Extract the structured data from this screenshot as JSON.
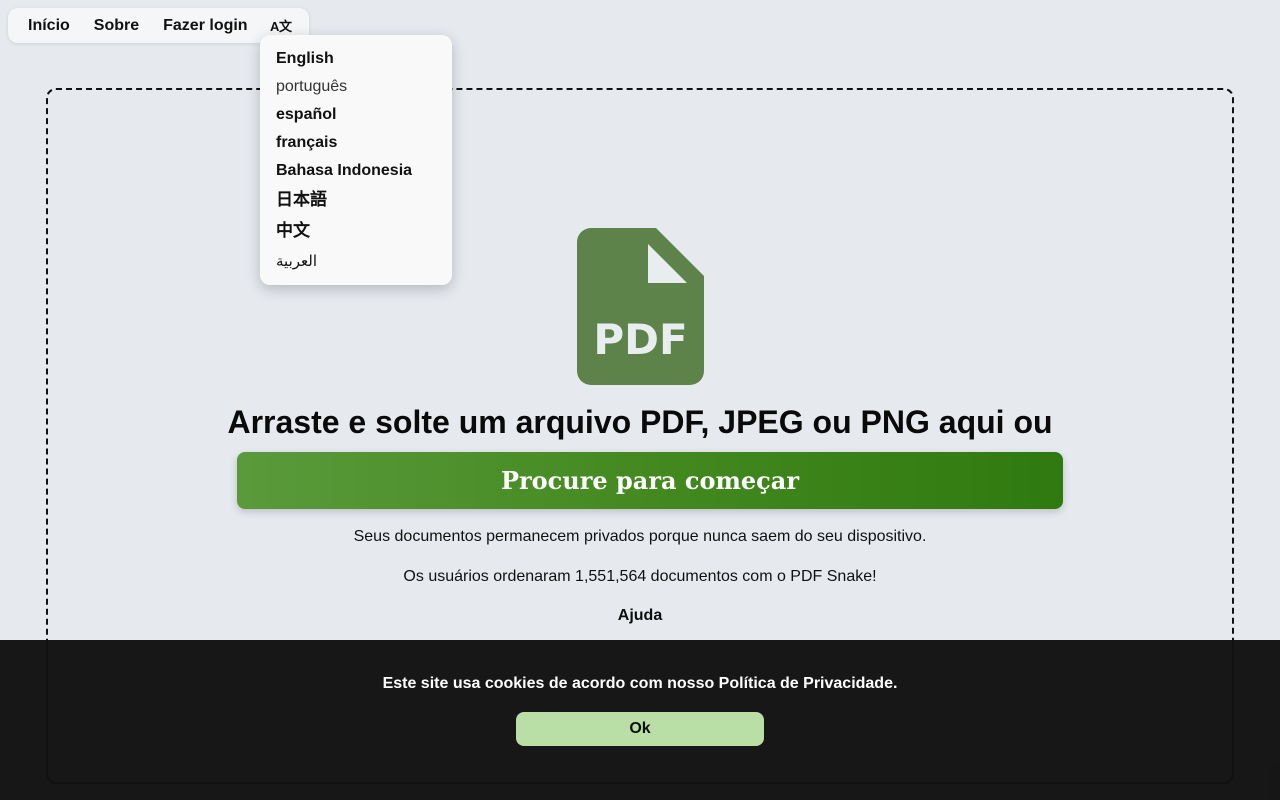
{
  "nav": {
    "home": "Início",
    "about": "Sobre",
    "login": "Fazer login",
    "language_icon": "translate-icon"
  },
  "language_menu": {
    "items": [
      "English",
      "português",
      "español",
      "français",
      "Bahasa Indonesia",
      "日本語",
      "中文",
      "العربية"
    ],
    "selected": "português"
  },
  "dropzone": {
    "icon": "pdf-file-icon",
    "icon_text": "PDF",
    "headline": "Arraste e solte um arquivo PDF, JPEG ou PNG aqui ou",
    "browse_label": "Procure para começar",
    "privacy_note": "Seus documentos permanecem privados porque nunca saem do seu dispositivo.",
    "stats_note": "Os usuários ordenaram 1,551,564 documentos com o PDF Snake!",
    "help_label": "Ajuda"
  },
  "cookie": {
    "message": "Este site usa cookies de acordo com nosso Política de Privacidade.",
    "ok_label": "Ok"
  },
  "colors": {
    "page_bg": "#e6eaef",
    "pdf_icon": "#5e834a",
    "button_start": "#5a9a3c",
    "button_end": "#2f7a10",
    "cookie_bg": "#121212",
    "cookie_button": "#b9dfa7"
  }
}
